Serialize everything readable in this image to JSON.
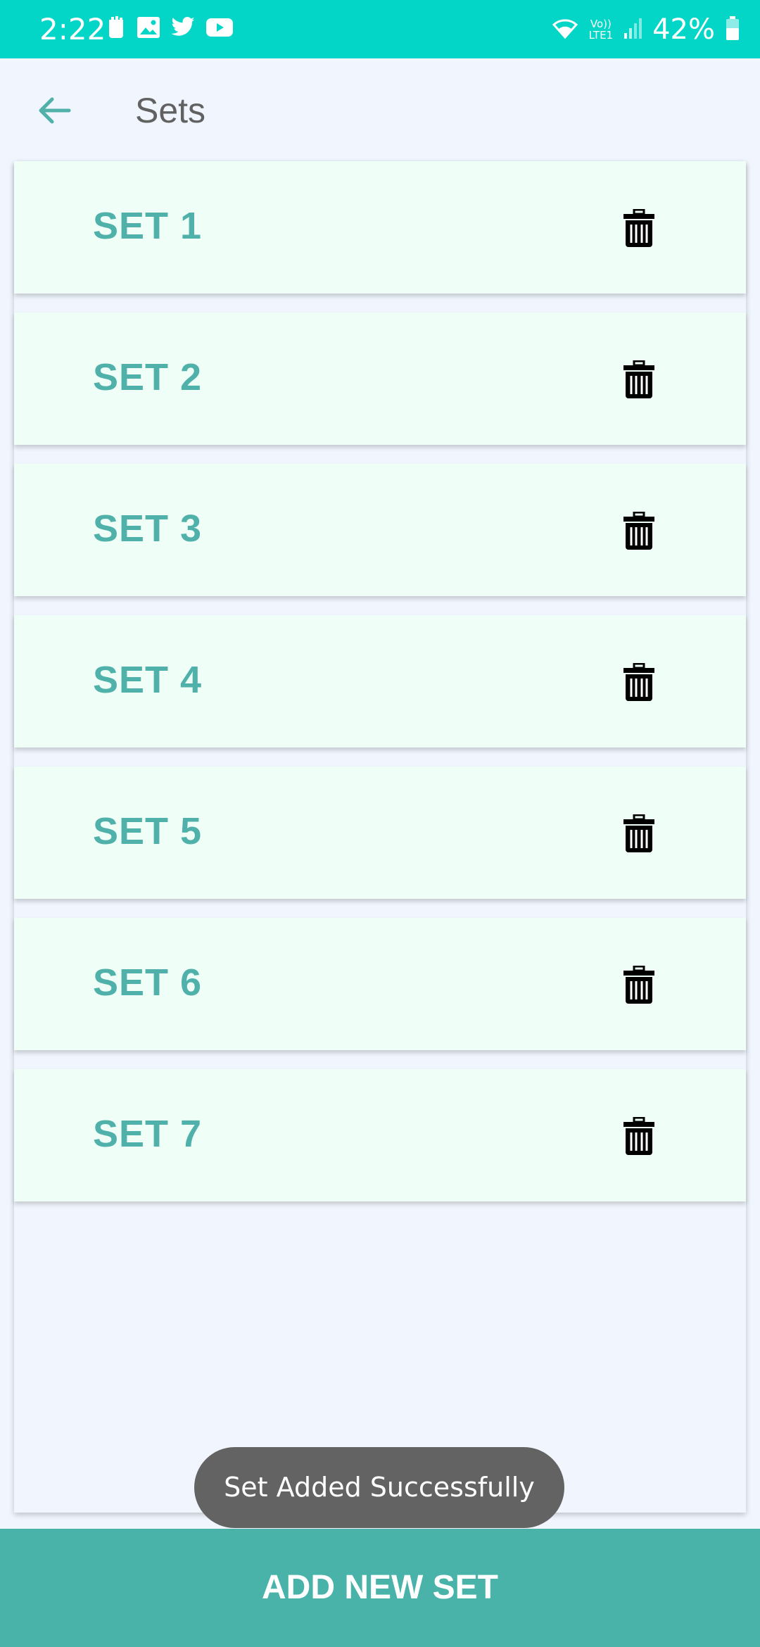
{
  "status_bar": {
    "time": "2:22",
    "network_label_top": "Vo))",
    "network_label_bottom": "LTE1",
    "battery_percent": "42%",
    "left_icons": [
      "notification-icon",
      "image-icon",
      "twitter-icon",
      "youtube-icon"
    ],
    "right_icons": [
      "wifi-icon",
      "signal-icon",
      "battery-icon"
    ]
  },
  "app_bar": {
    "title": "Sets",
    "back_icon": "arrow-left-icon"
  },
  "sets": [
    {
      "label": "SET 1"
    },
    {
      "label": "SET 2"
    },
    {
      "label": "SET 3"
    },
    {
      "label": "SET 4"
    },
    {
      "label": "SET 5"
    },
    {
      "label": "SET 6"
    },
    {
      "label": "SET 7"
    }
  ],
  "delete_icon": "trash-icon",
  "toast": {
    "message": "Set Added Successfully"
  },
  "bottom_button": {
    "label": "ADD NEW SET"
  },
  "colors": {
    "status_bar": "#03d6c6",
    "accent": "#4fb1a9",
    "card_background": "#effff7",
    "page_background": "#f1f6fe",
    "button_background": "#4ab3a9",
    "toast_background": "#636363"
  }
}
